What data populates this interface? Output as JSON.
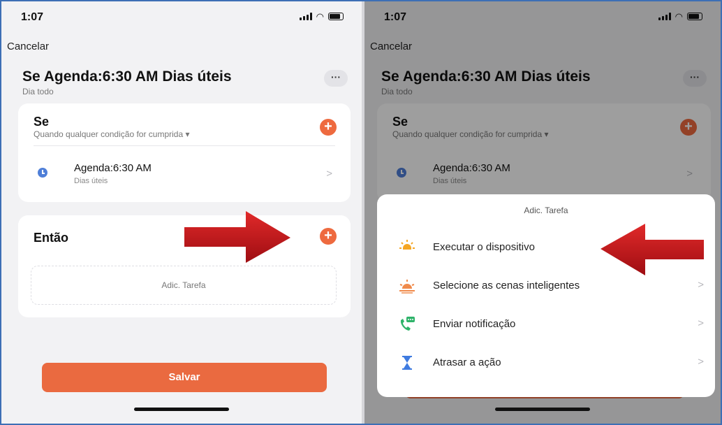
{
  "left": {
    "status_time": "1:07",
    "cancel": "Cancelar",
    "title": "Se Agenda:6:30 AM Dias úteis",
    "subtitle": "Dia todo",
    "more": "···",
    "if_card": {
      "title": "Se",
      "subtitle": "Quando qualquer condição for cumprida ▾",
      "plus": "+",
      "schedule_title": "Agenda:6:30 AM",
      "schedule_sub": "Dias úteis",
      "chevron": ">"
    },
    "then_card": {
      "title": "Então",
      "plus": "+",
      "add_task": "Adic. Tarefa"
    },
    "save": "Salvar"
  },
  "right": {
    "status_time": "1:07",
    "cancel": "Cancelar",
    "title": "Se Agenda:6:30 AM Dias úteis",
    "subtitle": "Dia todo",
    "more": "···",
    "if_card": {
      "title": "Se",
      "subtitle": "Quando qualquer condição for cumprida ▾",
      "plus": "+",
      "schedule_title": "Agenda:6:30 AM",
      "schedule_sub": "Dias úteis",
      "chevron": ">"
    },
    "sheet": {
      "title": "Adic. Tarefa",
      "options": [
        {
          "label": "Executar o dispositivo",
          "icon": "sun-device-icon",
          "chevron": ""
        },
        {
          "label": "Selecione as cenas inteligentes",
          "icon": "sunrise-icon",
          "chevron": ">"
        },
        {
          "label": "Enviar notificação",
          "icon": "phone-message-icon",
          "chevron": ">"
        },
        {
          "label": "Atrasar a ação",
          "icon": "hourglass-icon",
          "chevron": ">"
        }
      ]
    }
  },
  "colors": {
    "accent": "#ea6a40",
    "arrow": "#c2161a",
    "clock": "#4f7fd8",
    "frame": "#3d6fb5"
  }
}
